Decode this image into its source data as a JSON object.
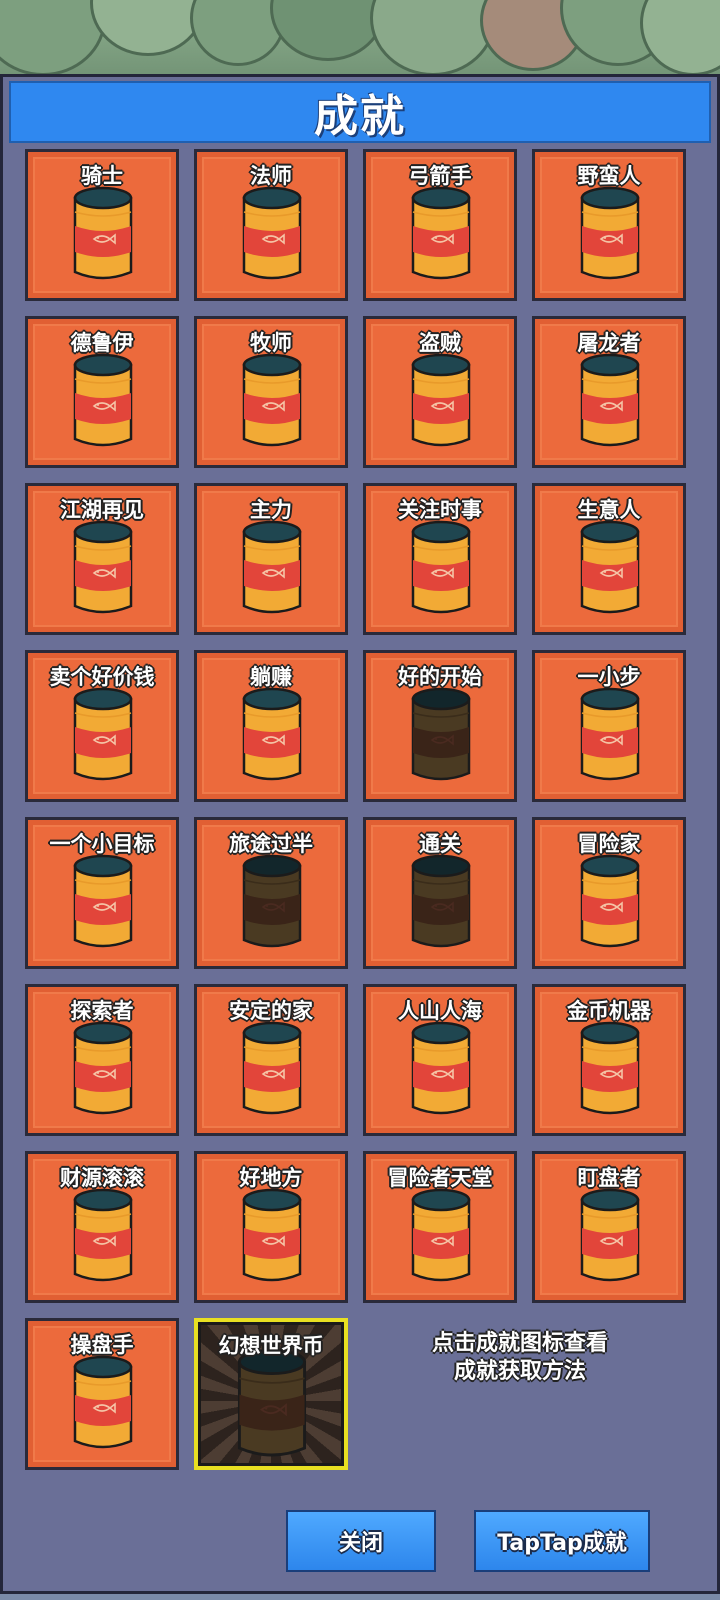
{
  "header": {
    "title": "成就"
  },
  "achievements": [
    {
      "label": "骑士",
      "state": "unlocked"
    },
    {
      "label": "法师",
      "state": "unlocked"
    },
    {
      "label": "弓箭手",
      "state": "unlocked"
    },
    {
      "label": "野蛮人",
      "state": "unlocked"
    },
    {
      "label": "德鲁伊",
      "state": "unlocked"
    },
    {
      "label": "牧师",
      "state": "unlocked"
    },
    {
      "label": "盗贼",
      "state": "unlocked"
    },
    {
      "label": "屠龙者",
      "state": "unlocked"
    },
    {
      "label": "江湖再见",
      "state": "unlocked"
    },
    {
      "label": "主力",
      "state": "unlocked"
    },
    {
      "label": "关注时事",
      "state": "unlocked"
    },
    {
      "label": "生意人",
      "state": "unlocked"
    },
    {
      "label": "卖个好价钱",
      "state": "unlocked"
    },
    {
      "label": "躺赚",
      "state": "unlocked"
    },
    {
      "label": "好的开始",
      "state": "locked"
    },
    {
      "label": "一小步",
      "state": "unlocked"
    },
    {
      "label": "一个小目标",
      "state": "unlocked"
    },
    {
      "label": "旅途过半",
      "state": "locked"
    },
    {
      "label": "通关",
      "state": "locked"
    },
    {
      "label": "冒险家",
      "state": "unlocked"
    },
    {
      "label": "探索者",
      "state": "unlocked"
    },
    {
      "label": "安定的家",
      "state": "unlocked"
    },
    {
      "label": "人山人海",
      "state": "unlocked"
    },
    {
      "label": "金币机器",
      "state": "unlocked"
    },
    {
      "label": "财源滚滚",
      "state": "unlocked"
    },
    {
      "label": "好地方",
      "state": "unlocked"
    },
    {
      "label": "冒险者天堂",
      "state": "unlocked"
    },
    {
      "label": "盯盘者",
      "state": "unlocked"
    },
    {
      "label": "操盘手",
      "state": "unlocked"
    },
    {
      "label": "幻想世界币",
      "state": "featured-locked"
    }
  ],
  "hint": {
    "line1": "点击成就图标查看",
    "line2": "成就获取方法"
  },
  "buttons": {
    "close": "关闭",
    "taptap": "TapTap成就"
  },
  "colors": {
    "tile": "#ec6a3c",
    "panel": "#6a6f97",
    "title_bar": "#2f88f0",
    "can_body": "#f2aa35",
    "can_band": "#e2453a",
    "can_lid": "#1f4650",
    "featured_border": "#e8e022"
  }
}
